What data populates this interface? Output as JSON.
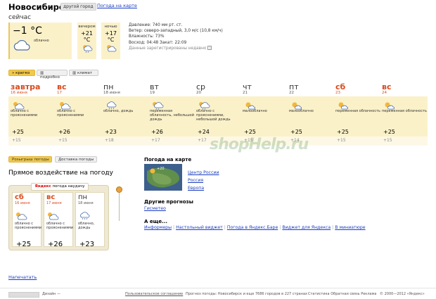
{
  "header": {
    "city": "Новосибирск",
    "other_city_btn": "другой город",
    "map_link": "Погода на карте"
  },
  "now": {
    "title": "сейчас",
    "temp": "−1 °C",
    "sky": "облачно",
    "evening": {
      "label": "вечером",
      "temp": "+21 °C"
    },
    "night": {
      "label": "ночью",
      "temp": "+17 °C"
    },
    "pressure": "Давление: 740 мм рт. ст.",
    "wind": "Ветер: северо-западный, 3,0 м/с (10,8 км/ч)",
    "humidity": "Влажность: 73%",
    "sun": "Восход: 04:48 Закат: 22:09",
    "registered": "Данные зарегистрированы недавно"
  },
  "tabs": [
    "кратко",
    "подробно",
    "климат"
  ],
  "days": [
    {
      "name": "завтра",
      "date": "16 июня",
      "weekend": true,
      "cond": "облачно с прояснениями",
      "day": "+25",
      "night": "+15",
      "icon": "partly-cloudy-icon"
    },
    {
      "name": "вс",
      "date": "17",
      "weekend": true,
      "cond": "облачно с прояснениями",
      "day": "+26",
      "night": "+15",
      "icon": "partly-cloudy-icon"
    },
    {
      "name": "пн",
      "date": "18 июня",
      "weekend": false,
      "cond": "облачно, дождь",
      "day": "+23",
      "night": "+18",
      "icon": "rain-cloud-icon"
    },
    {
      "name": "вт",
      "date": "19",
      "weekend": false,
      "cond": "переменная облачность, небольшой дождь",
      "day": "+26",
      "night": "+17",
      "icon": "sun-rain-icon"
    },
    {
      "name": "ср",
      "date": "20",
      "weekend": false,
      "cond": "облачно с прояснениями, небольшой дождь",
      "day": "+24",
      "night": "+17",
      "icon": "sun-rain-icon"
    },
    {
      "name": "чт",
      "date": "21",
      "weekend": false,
      "cond": "малооблачно",
      "day": "+25",
      "night": "+15",
      "icon": "sun-cloud-icon"
    },
    {
      "name": "пт",
      "date": "22",
      "weekend": false,
      "cond": "малооблачно",
      "day": "+25",
      "night": "+14",
      "icon": "sun-cloud-icon"
    },
    {
      "name": "сб",
      "date": "23",
      "weekend": true,
      "cond": "переменная облачность",
      "day": "+25",
      "night": "+15",
      "icon": "sun-cloud-icon"
    },
    {
      "name": "вс",
      "date": "24",
      "weekend": true,
      "cond": "переменная облачность",
      "day": "+25",
      "night": "+15",
      "icon": "sun-cloud-icon"
    }
  ],
  "widget_tabs": [
    "Розыгрыш погоды",
    "Доставка погоды"
  ],
  "widget": {
    "title": "Прямое воздействие на погоду",
    "brand": "Яндекс",
    "brand_text": "погода наудачу",
    "cells": [
      {
        "name": "сб",
        "date": "16 июня",
        "weekend": true,
        "cond": "облачно с прояснениями",
        "temp": "+25"
      },
      {
        "name": "вс",
        "date": "17 июня",
        "weekend": true,
        "cond": "облачно с прояснениями",
        "temp": "+26"
      },
      {
        "name": "пн",
        "date": "18 июня",
        "weekend": false,
        "cond": "облачно, дождь",
        "temp": "+23"
      }
    ]
  },
  "map": {
    "title": "Погода на карте",
    "badge": "+20",
    "links": [
      "Центр России",
      "Россия",
      "Европа"
    ]
  },
  "other": {
    "title": "Другие прогнозы",
    "link": "Гисметео"
  },
  "more": {
    "title": "А еще...",
    "links": [
      "Информеры",
      "Настольный виджет",
      "Погода в Яндекс.Баре",
      "Виджет для Яндекса",
      "В миниатюре"
    ]
  },
  "print": "Напечатать",
  "watermark": "shopHelp.ru",
  "footer": {
    "design": "Дизайн —",
    "agreement": "Пользовательское соглашение",
    "forecast": "Прогноз погоды: Новосибирск и еще 7686 городов в 227 странах",
    "stats": "Статистика Обратная связь Реклама",
    "copyright": "© 2000—2012 «Яндекс»"
  },
  "colors": {
    "accent": "#f2c94c",
    "band": "#fbf1c9",
    "weekend": "#d94a1e",
    "link": "#1a3dc1"
  }
}
